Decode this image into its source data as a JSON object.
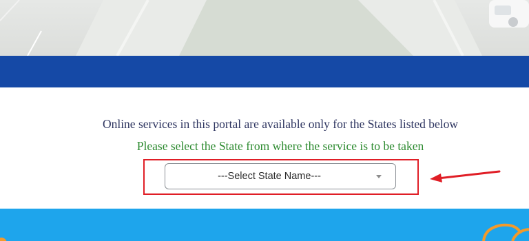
{
  "notice": {
    "availability_text": "Online services in this portal are available only for the States listed below",
    "instruction_text": "Please select the State from where the service is to be taken"
  },
  "state_select": {
    "selected_label": "---Select State Name---"
  },
  "colors": {
    "header_bar": "#1549a6",
    "footer_band": "#1ea5ec",
    "highlight": "#e01e26",
    "instruction_text": "#2c8a2f"
  }
}
